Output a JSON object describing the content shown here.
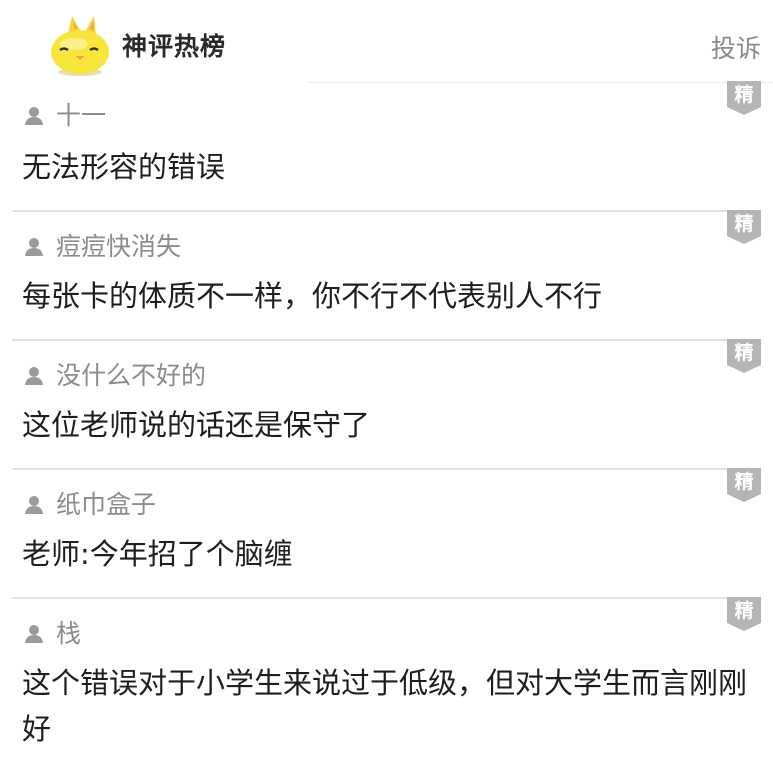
{
  "header": {
    "brand": "神评热榜",
    "report_label": "投诉",
    "mascot_icon": "yellow-mascot-icon"
  },
  "badge_label": "精",
  "comments": [
    {
      "username": "十一",
      "text": "无法形容的错误"
    },
    {
      "username": "痘痘快消失",
      "text": "每张卡的体质不一样，你不行不代表别人不行"
    },
    {
      "username": "没什么不好的",
      "text": "这位老师说的话还是保守了"
    },
    {
      "username": "纸巾盒子",
      "text": "老师:今年招了个脑缠"
    },
    {
      "username": "栈",
      "text": "这个错误对于小学生来说过于低级，但对大学生而言刚刚好"
    }
  ],
  "colors": {
    "badge": "#b5b5b5",
    "divider": "#e2e2e2",
    "username": "#8c8c8c",
    "report": "#8a8a8a",
    "mascot": "#f7e53b"
  }
}
